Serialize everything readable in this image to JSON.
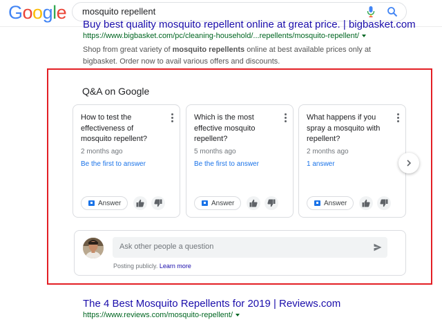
{
  "header": {
    "logo_letters": [
      "G",
      "o",
      "o",
      "g",
      "l",
      "e"
    ],
    "logo_colors": [
      "#4285F4",
      "#EA4335",
      "#FBBC05",
      "#4285F4",
      "#34A853",
      "#EA4335"
    ],
    "search_query": "mosquito repellent"
  },
  "results": [
    {
      "title": "Buy best quality mosquito repellent online at great price. | bigbasket.com",
      "url": "https://www.bigbasket.com/pc/cleaning-household/...repellents/mosquito-repellent/",
      "snippet_parts": [
        "Shop from great variety of ",
        "mosquito repellents",
        " online at best available prices only at bigbasket. Order now to avail various offers and discounts."
      ]
    },
    {
      "title": "The 4 Best Mosquito Repellents for 2019 | Reviews.com",
      "url": "https://www.reviews.com/mosquito-repellent/"
    }
  ],
  "qa": {
    "heading": "Q&A on Google",
    "cards": [
      {
        "question": "How to test the effectiveness of mosquito repellent?",
        "time": "2 months ago",
        "answer_link": "Be the first to answer",
        "answer_button": "Answer"
      },
      {
        "question": "Which is the most effective mosquito repellent?",
        "time": "5 months ago",
        "answer_link": "Be the first to answer",
        "answer_button": "Answer"
      },
      {
        "question": "What happens if you spray a mosquito with repellent?",
        "time": "2 months ago",
        "answer_link": "1 answer",
        "answer_button": "Answer"
      }
    ],
    "ask": {
      "placeholder": "Ask other people a question",
      "posting_note": "Posting publicly.",
      "learn_more": "Learn more"
    }
  },
  "colors": {
    "link": "#1a0dab",
    "url_green": "#006621",
    "highlight_border": "#e31e24",
    "accent_blue": "#1a73e8"
  }
}
